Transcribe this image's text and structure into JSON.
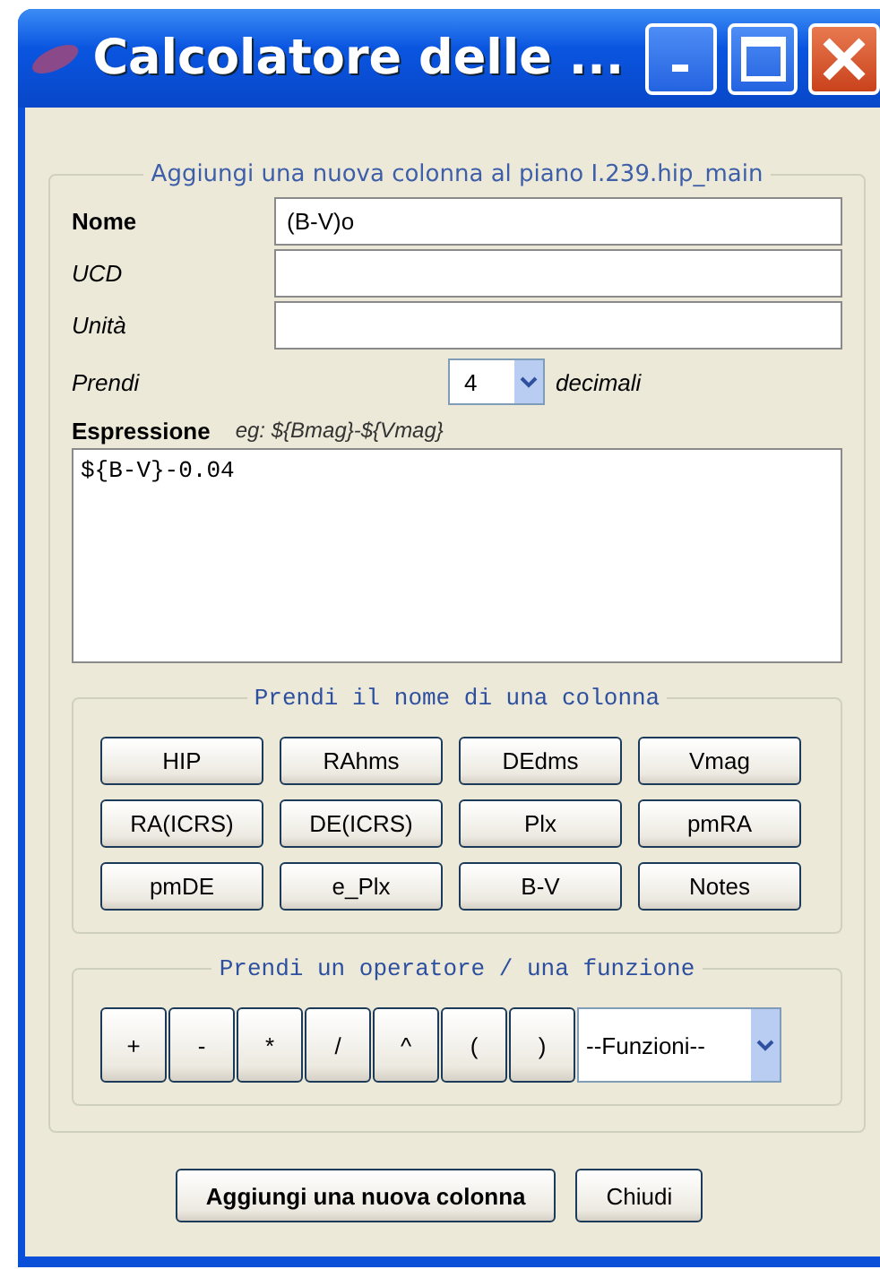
{
  "window": {
    "title": "Calcolatore delle ..."
  },
  "form": {
    "legend": "Aggiungi una nuova colonna al piano I.239.hip_main",
    "fields": [
      {
        "label": "Nome",
        "bold": true,
        "value": "(B-V)o"
      },
      {
        "label": "UCD",
        "bold": false
      },
      {
        "label": "Unità",
        "bold": false
      }
    ],
    "decimals": {
      "label": "Prendi",
      "value": "4",
      "suffix": "decimali"
    },
    "expression": {
      "label": "Espressione",
      "hint": "eg: ${Bmag}-${Vmag}",
      "value": "${B-V}-0.04"
    }
  },
  "columns_group": {
    "legend": "Prendi il nome di una colonna",
    "buttons": [
      "HIP",
      "RAhms",
      "DEdms",
      "Vmag",
      "RA(ICRS)",
      "DE(ICRS)",
      "Plx",
      "pmRA",
      "pmDE",
      "e_Plx",
      "B-V",
      "Notes"
    ]
  },
  "operators_group": {
    "legend": "Prendi un operatore / una funzione",
    "buttons": [
      "+",
      "-",
      "*",
      "/",
      "^",
      "(",
      ")"
    ],
    "functions_select": "--Funzioni--"
  },
  "buttons": [
    {
      "label": "Aggiungi una nuova colonna",
      "default": true
    },
    {
      "label": "Chiudi",
      "default": false
    }
  ]
}
